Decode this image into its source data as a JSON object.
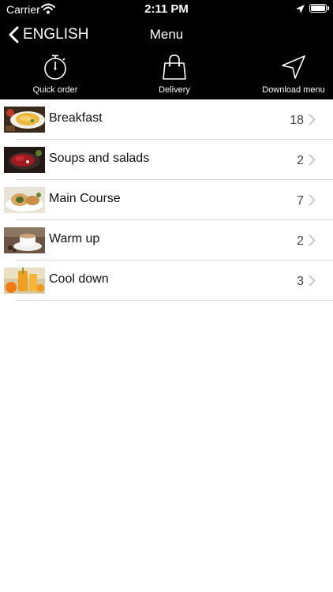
{
  "status_bar": {
    "carrier": "Carrier",
    "time": "2:11 PM"
  },
  "nav": {
    "back_label": "ENGLISH",
    "title": "Menu"
  },
  "toolbar": {
    "quick_order": {
      "label": "Quick order",
      "icon": "stopwatch-icon"
    },
    "delivery": {
      "label": "Delivery",
      "icon": "shopping-bag-icon"
    },
    "download_menu": {
      "label": "Download menu",
      "icon": "location-arrow-icon"
    }
  },
  "categories": [
    {
      "label": "Breakfast",
      "count": "18"
    },
    {
      "label": "Soups and salads",
      "count": "2"
    },
    {
      "label": "Main Course",
      "count": "7"
    },
    {
      "label": "Warm up",
      "count": "2"
    },
    {
      "label": "Cool down",
      "count": "3"
    }
  ],
  "colors": {
    "bar_background": "#000000",
    "bar_text": "#ffffff",
    "separator": "#d9d9d9",
    "chevron": "#c7c7cc"
  }
}
